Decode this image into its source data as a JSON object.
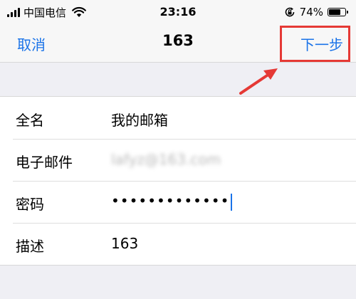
{
  "status_bar": {
    "carrier": "中国电信",
    "time": "23:16",
    "battery_text": "74%",
    "battery_level": 0.74,
    "icons": [
      "signal-bars-icon",
      "wifi-icon",
      "rotation-lock-icon",
      "battery-icon"
    ]
  },
  "nav": {
    "cancel": "取消",
    "title": "163",
    "next": "下一步"
  },
  "form": {
    "name_label": "全名",
    "name_value": "我的邮箱",
    "email_label": "电子邮件",
    "email_value": "lafyz@163.com",
    "password_label": "密码",
    "password_value": "•••••••••••••",
    "description_label": "描述",
    "description_value": "163"
  },
  "colors": {
    "accent": "#1a73e8",
    "annotation": "#e53935"
  }
}
